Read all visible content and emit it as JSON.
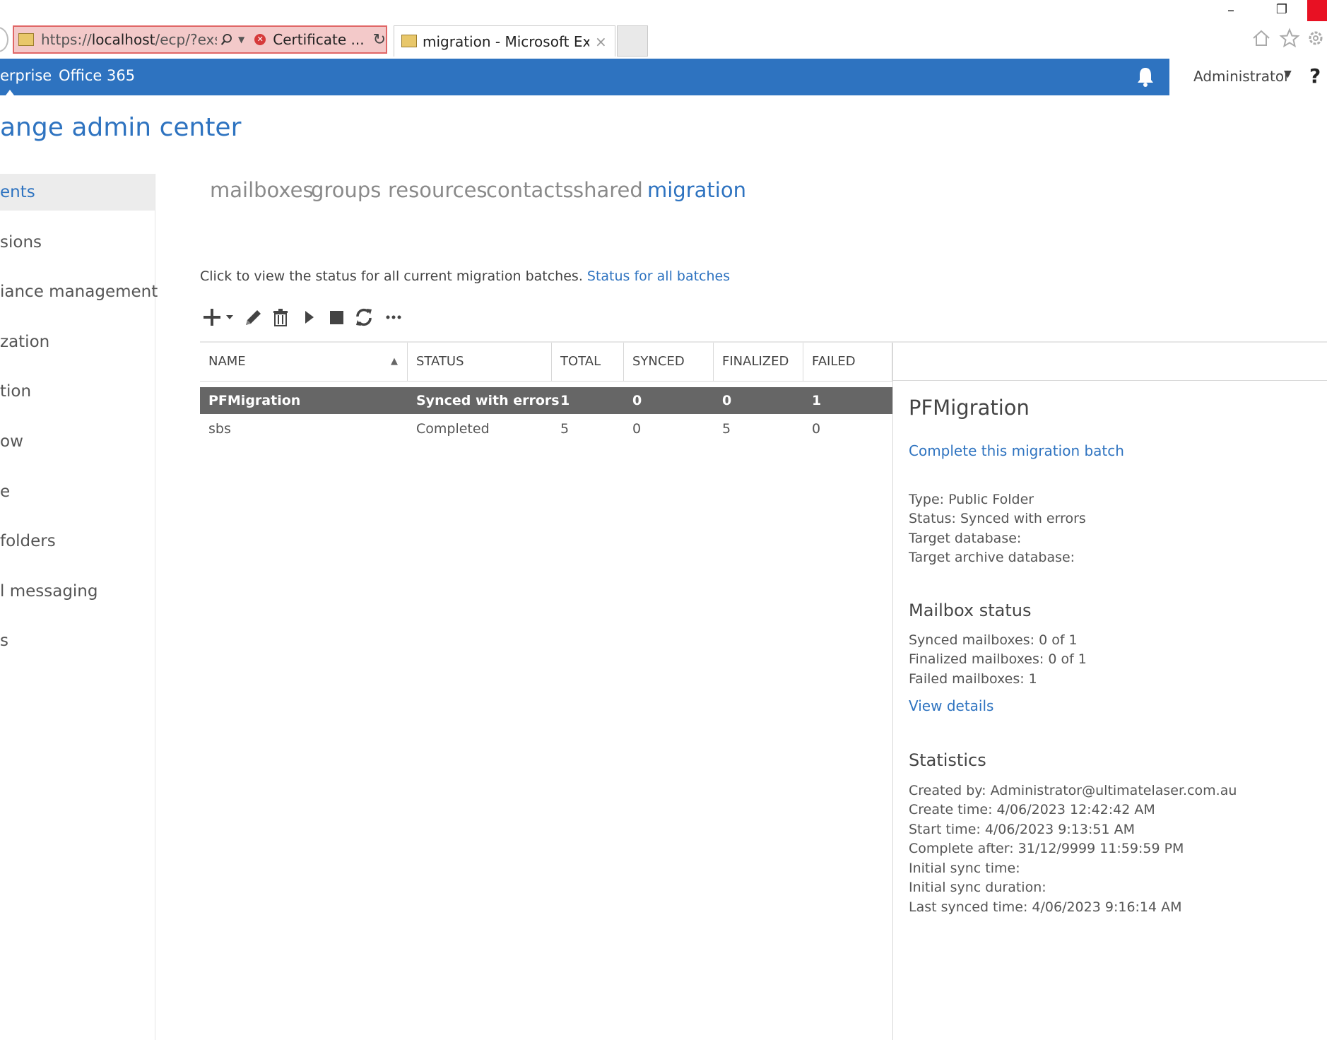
{
  "browser": {
    "address_prefix": "https://",
    "address_host": "localhost",
    "address_path": "/ecp/?exsvurl=",
    "certificate_label": "Certificate ...",
    "tab_title": "migration - Microsoft Exch...",
    "tab_close": "×",
    "minimize": "–",
    "restore": "❐",
    "icons": [
      "search-icon",
      "dropdown-icon",
      "certificate-error-icon",
      "refresh-icon",
      "home-icon",
      "favorites-star-icon",
      "settings-gear-icon"
    ]
  },
  "topbar": {
    "links": [
      "erprise",
      "Office 365"
    ],
    "user": "Administrator",
    "help": "?"
  },
  "app_title": "ange admin center",
  "leftnav": {
    "items": [
      {
        "label": "ents",
        "selected": true
      },
      {
        "label": "sions"
      },
      {
        "label": "iance management"
      },
      {
        "label": "zation"
      },
      {
        "label": "tion"
      },
      {
        "label": "ow"
      },
      {
        "label": "e"
      },
      {
        "label": " folders"
      },
      {
        "label": "l messaging"
      },
      {
        "label": "s"
      }
    ]
  },
  "tabs": [
    "mailboxes",
    "groups",
    "resources",
    "contacts",
    "shared",
    "migration"
  ],
  "active_tab": "migration",
  "info": {
    "text": "Click to view the status for all current migration batches.",
    "link": "Status for all batches"
  },
  "toolbar": [
    "add-icon",
    "edit-icon",
    "delete-icon",
    "start-icon",
    "stop-icon",
    "refresh-icon",
    "more-icon"
  ],
  "grid": {
    "columns": [
      "NAME",
      "STATUS",
      "TOTAL",
      "SYNCED",
      "FINALIZED",
      "FAILED"
    ],
    "sort_indicator": "▲",
    "rows": [
      {
        "name": "PFMigration",
        "status": "Synced with errors",
        "total": "1",
        "synced": "0",
        "finalized": "0",
        "failed": "1",
        "selected": true
      },
      {
        "name": "sbs",
        "status": "Completed",
        "total": "5",
        "synced": "0",
        "finalized": "5",
        "failed": "0"
      }
    ]
  },
  "details": {
    "title": "PFMigration",
    "complete_link": "Complete this migration batch",
    "type": "Type: Public Folder",
    "status": "Status: Synced with errors",
    "target_db": "Target database:",
    "target_archive_db": "Target archive database:",
    "mailbox_status_heading": "Mailbox status",
    "synced_mailboxes": "Synced mailboxes: 0 of 1",
    "finalized_mailboxes": "Finalized mailboxes: 0 of 1",
    "failed_mailboxes": "Failed mailboxes: 1",
    "view_details": "View details",
    "statistics_heading": "Statistics",
    "created_by": "Created by: Administrator@ultimatelaser.com.au",
    "create_time": "Create time: 4/06/2023 12:42:42 AM",
    "start_time": "Start time: 4/06/2023 9:13:51 AM",
    "complete_after": "Complete after: 31/12/9999 11:59:59 PM",
    "initial_sync_time": "Initial sync time:",
    "initial_sync_duration": "Initial sync duration:",
    "last_synced_time": "Last synced time: 4/06/2023 9:16:14 AM"
  },
  "colors": {
    "accent": "#2e73c0",
    "selected_row": "#666666",
    "address_bar_error": "#f3c9c9",
    "close_button": "#e81123"
  }
}
